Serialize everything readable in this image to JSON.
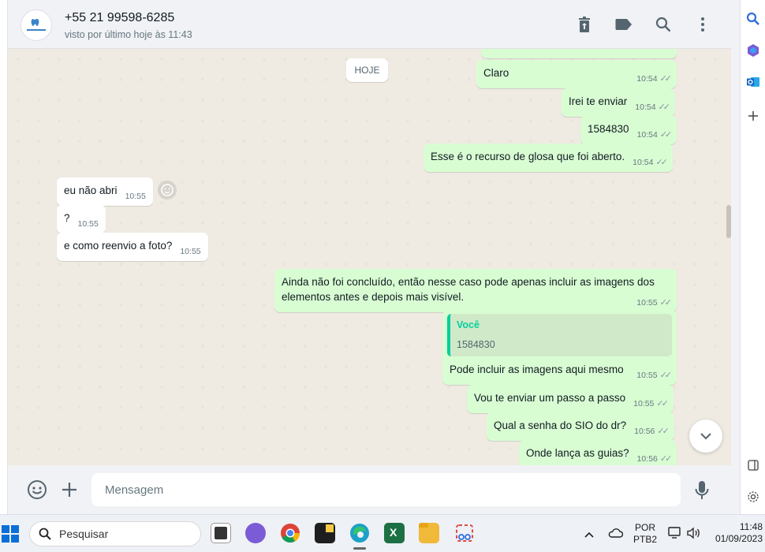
{
  "header": {
    "contact_name": "+55 21 99598-6285",
    "status": "visto por último hoje às 11:43",
    "avatar_text": "CLÍNICA DENTAL"
  },
  "chat": {
    "day_label": "HOJE",
    "messages": [
      {
        "text": "Claro",
        "time": "10:54",
        "dir": "out"
      },
      {
        "text": "Irei te enviar",
        "time": "10:54",
        "dir": "out"
      },
      {
        "text": "1584830",
        "time": "10:54",
        "dir": "out"
      },
      {
        "text": "Esse é o recurso de glosa que foi aberto.",
        "time": "10:54",
        "dir": "out"
      },
      {
        "text": "eu não abri",
        "time": "10:55",
        "dir": "in"
      },
      {
        "text": "?",
        "time": "10:55",
        "dir": "in"
      },
      {
        "text": "e como reenvio a foto?",
        "time": "10:55",
        "dir": "in"
      },
      {
        "text": "Ainda não foi concluído, então nesse caso pode apenas incluir as imagens dos elementos antes e depois mais visível.",
        "time": "10:55",
        "dir": "out"
      },
      {
        "text": "Pode incluir as imagens aqui mesmo",
        "time": "10:55",
        "dir": "out",
        "quote_author": "Você",
        "quote_text": "1584830"
      },
      {
        "text": "Vou te enviar um passo a passo",
        "time": "10:55",
        "dir": "out"
      },
      {
        "text": "Qual a senha do SIO do dr?",
        "time": "10:56",
        "dir": "out"
      },
      {
        "text": "Onde lança as guias?",
        "time": "10:56",
        "dir": "out"
      }
    ]
  },
  "composer": {
    "placeholder": "Mensagem"
  },
  "taskbar": {
    "search_placeholder": "Pesquisar",
    "lang_top": "POR",
    "lang_bottom": "PTB2",
    "time": "11:48",
    "date": "01/09/2023"
  },
  "colors": {
    "outgoing_bubble": "#d9fdd3",
    "incoming_bubble": "#ffffff",
    "chat_background": "#efeae2",
    "accent": "#06cf9c"
  }
}
